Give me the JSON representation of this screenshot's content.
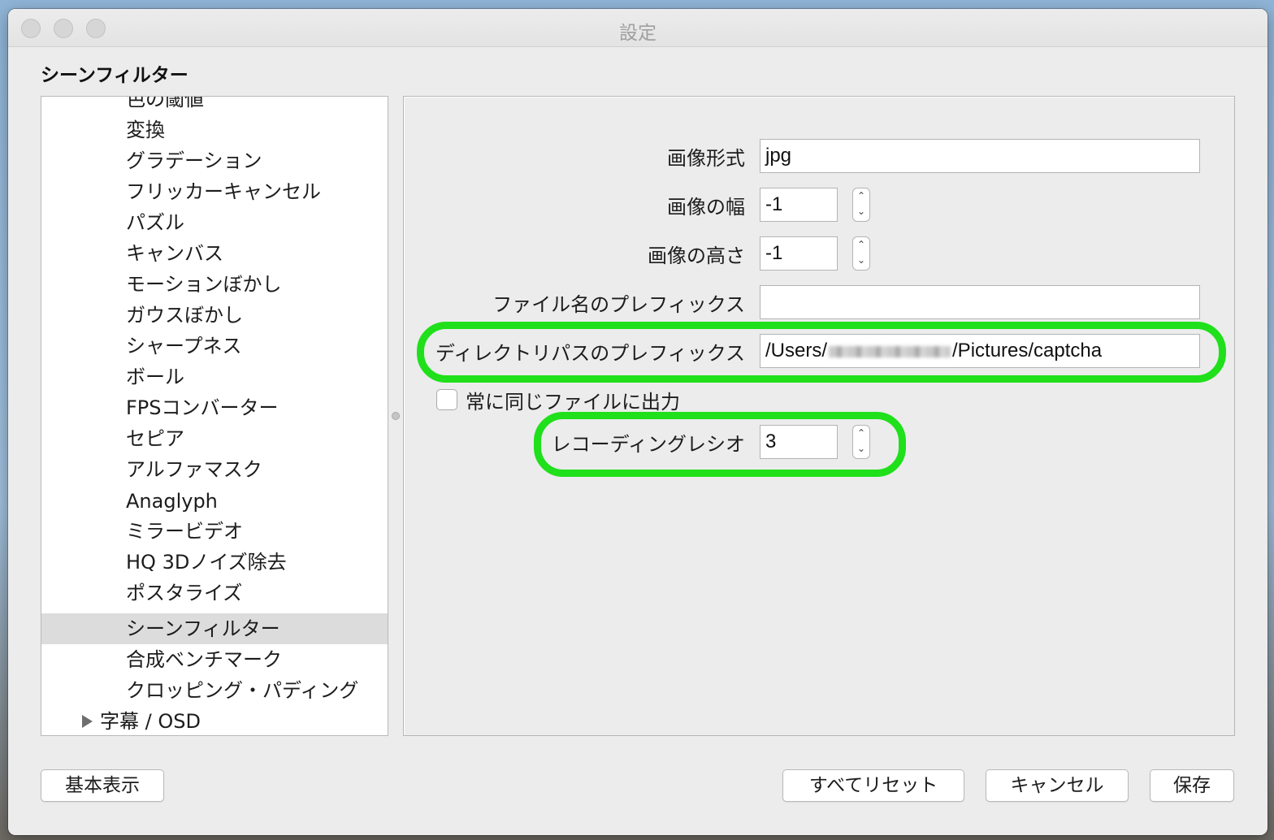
{
  "window": {
    "title": "設定"
  },
  "section_title": "シーンフィルター",
  "filter_list": [
    {
      "label": "色の閾値",
      "selected": false
    },
    {
      "label": "変換",
      "selected": false
    },
    {
      "label": "グラデーション",
      "selected": false
    },
    {
      "label": "フリッカーキャンセル",
      "selected": false
    },
    {
      "label": "パズル",
      "selected": false
    },
    {
      "label": "キャンバス",
      "selected": false
    },
    {
      "label": "モーションぼかし",
      "selected": false
    },
    {
      "label": "ガウスぼかし",
      "selected": false
    },
    {
      "label": "シャープネス",
      "selected": false
    },
    {
      "label": "ボール",
      "selected": false
    },
    {
      "label": "FPSコンバーター",
      "selected": false
    },
    {
      "label": "セピア",
      "selected": false
    },
    {
      "label": "アルファマスク",
      "selected": false
    },
    {
      "label": "Anaglyph",
      "selected": false
    },
    {
      "label": "ミラービデオ",
      "selected": false
    },
    {
      "label": "HQ 3Dノイズ除去",
      "selected": false
    },
    {
      "label": "ポスタライズ",
      "selected": false
    },
    {
      "label": "シーンフィルター",
      "selected": true
    },
    {
      "label": "合成ベンチマーク",
      "selected": false
    },
    {
      "label": "クロッピング・パディング",
      "selected": false
    }
  ],
  "subtitle_group": {
    "label": "字幕 / OSD",
    "expand_icon": "disclosure-triangle-right-icon"
  },
  "settings": {
    "image_format": {
      "label": "画像形式",
      "value": "jpg"
    },
    "image_width": {
      "label": "画像の幅",
      "value": "-1"
    },
    "image_height": {
      "label": "画像の高さ",
      "value": "-1"
    },
    "filename_prefix": {
      "label": "ファイル名のプレフィックス",
      "value": ""
    },
    "directory_prefix": {
      "label": "ディレクトリパスのプレフィックス",
      "value_start": "/Users/",
      "value_end": "/Pictures/captcha"
    },
    "always_same_file": {
      "label": "常に同じファイルに出力",
      "checked": false
    },
    "recording_ratio": {
      "label": "レコーディングレシオ",
      "value": "3"
    }
  },
  "stepper_glyphs": {
    "up": "⌃",
    "down": "⌄"
  },
  "buttons": {
    "basic_view": "基本表示",
    "reset_all": "すべてリセット",
    "cancel": "キャンセル",
    "save": "保存"
  },
  "colors": {
    "highlight": "#1fe01a",
    "selected_row": "#dcdcdc",
    "window_bg": "#ececec"
  }
}
